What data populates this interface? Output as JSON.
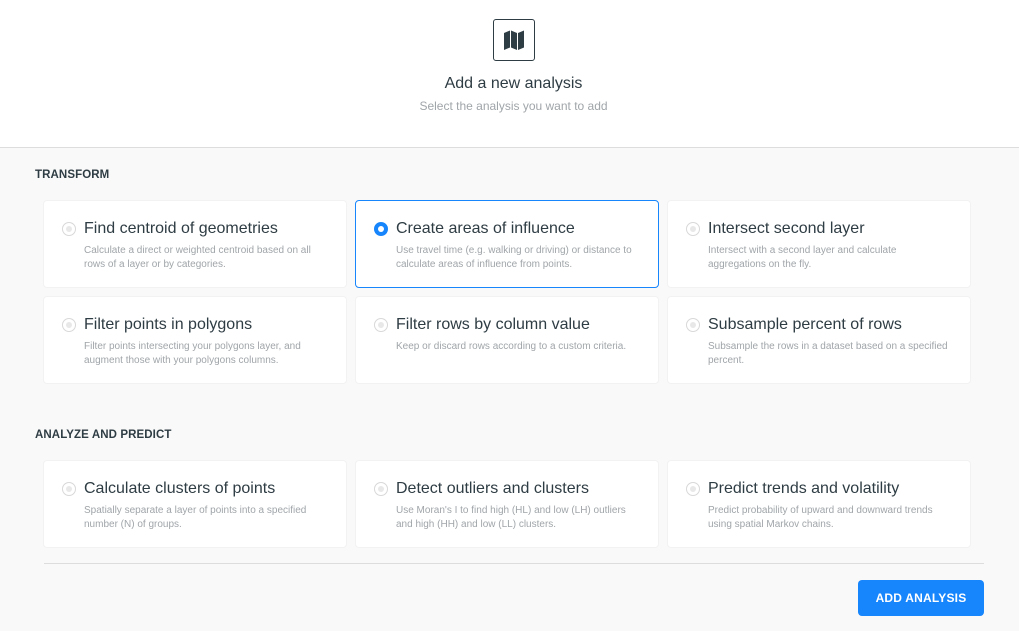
{
  "header": {
    "icon": "map-icon",
    "title": "Add a new analysis",
    "subtitle": "Select the analysis you want to add"
  },
  "sections": [
    {
      "title": "TRANSFORM",
      "cards": [
        {
          "title": "Find centroid of geometries",
          "description": "Calculate a direct or weighted centroid based on all rows of a layer or by categories.",
          "selected": false
        },
        {
          "title": "Create areas of influence",
          "description": "Use travel time (e.g. walking or driving) or distance to calculate areas of influence from points.",
          "selected": true
        },
        {
          "title": "Intersect second layer",
          "description": "Intersect with a second layer and calculate aggregations on the fly.",
          "selected": false
        },
        {
          "title": "Filter points in polygons",
          "description": "Filter points intersecting your polygons layer, and augment those with your polygons columns.",
          "selected": false
        },
        {
          "title": "Filter rows by column value",
          "description": "Keep or discard rows according to a custom criteria.",
          "selected": false
        },
        {
          "title": "Subsample percent of rows",
          "description": "Subsample the rows in a dataset based on a specified percent.",
          "selected": false
        }
      ]
    },
    {
      "title": "ANALYZE AND PREDICT",
      "cards": [
        {
          "title": "Calculate clusters of points",
          "description": "Spatially separate a layer of points into a specified number (N) of groups.",
          "selected": false
        },
        {
          "title": "Detect outliers and clusters",
          "description": "Use Moran's I to find high (HL) and low (LH) outliers and high (HH) and low (LL) clusters.",
          "selected": false
        },
        {
          "title": "Predict trends and volatility",
          "description": "Predict probability of upward and downward trends using spatial Markov chains.",
          "selected": false
        }
      ]
    }
  ],
  "footer": {
    "button_label": "ADD ANALYSIS"
  },
  "colors": {
    "accent": "#1785fb",
    "text": "#2e3c43",
    "muted": "#a0a5a9"
  }
}
